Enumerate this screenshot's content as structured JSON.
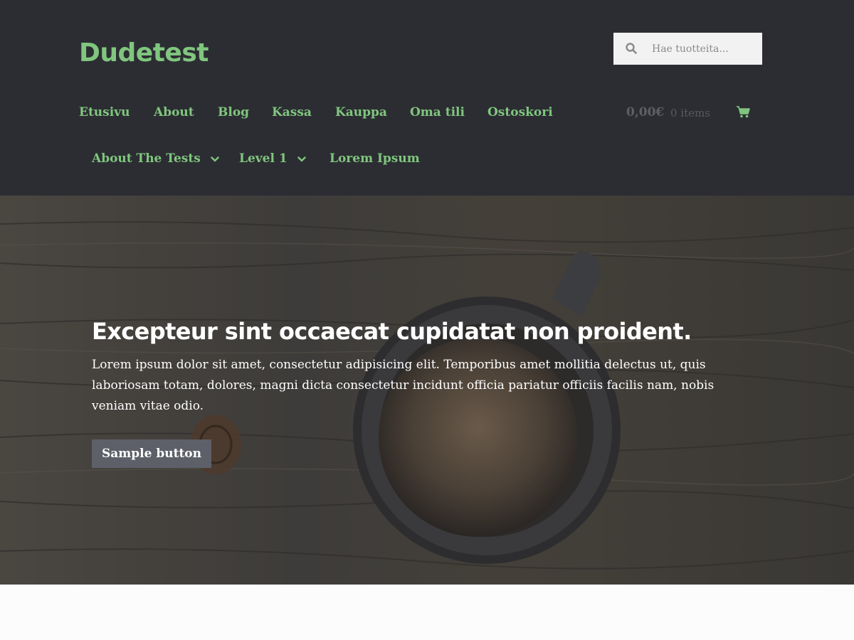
{
  "site": {
    "title": "Dudetest"
  },
  "search": {
    "placeholder": "Hae tuotteita..."
  },
  "nav": {
    "primary": [
      "Etusivu",
      "About",
      "Blog",
      "Kassa",
      "Kauppa",
      "Oma tili",
      "Ostoskori"
    ],
    "secondary": [
      "About The Tests",
      "Level 1",
      "Lorem Ipsum"
    ]
  },
  "cart": {
    "total": "0,00€",
    "count": "0 items"
  },
  "hero": {
    "title": "Excepteur sint occaecat cupidatat non proident.",
    "text": "Lorem ipsum dolor sit amet, consectetur adipisicing elit. Temporibus amet mollitia delectus ut, quis laboriosam totam, dolores, magni dicta consectetur incidunt officia pariatur officiis facilis nam, nobis veniam vitae odio.",
    "button": "Sample button"
  },
  "colors": {
    "header_bg": "#2c2d33",
    "accent": "#80c67e",
    "button_bg": "#5e6069"
  },
  "icons": {
    "search": "search-icon",
    "cart": "cart-icon",
    "dropdown": "chevron-down-icon"
  }
}
